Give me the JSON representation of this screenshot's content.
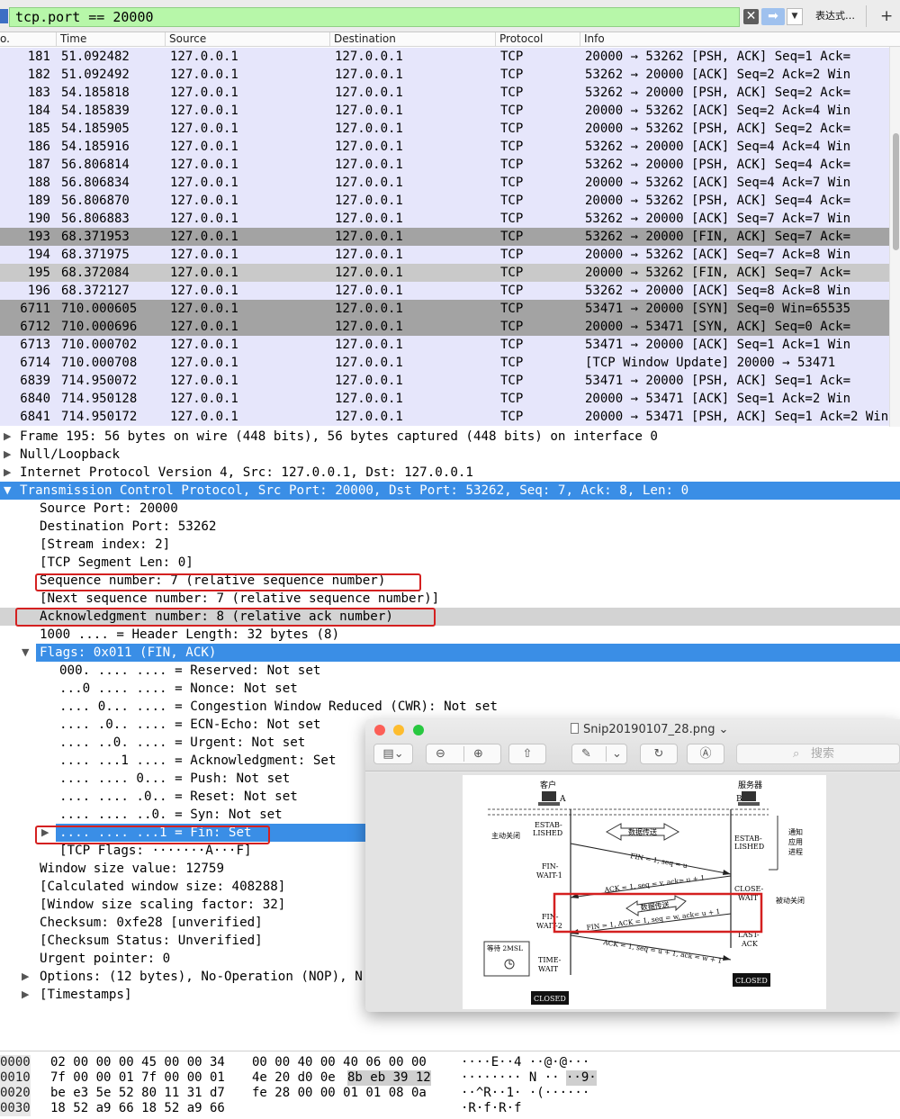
{
  "filter": {
    "value": "tcp.port == 20000",
    "clear_glyph": "✕",
    "apply_glyph": "➡",
    "dropdown_glyph": "▼",
    "expression_label": "表达式…",
    "add_glyph": "+"
  },
  "packet_list": {
    "columns": [
      "o.",
      "Time",
      "Source",
      "Destination",
      "Protocol",
      "Info"
    ],
    "rows": [
      {
        "no": "181",
        "time": "51.092482",
        "src": "127.0.0.1",
        "dst": "127.0.0.1",
        "proto": "TCP",
        "info": "20000 → 53262 [PSH, ACK] Seq=1 Ack="
      },
      {
        "no": "182",
        "time": "51.092492",
        "src": "127.0.0.1",
        "dst": "127.0.0.1",
        "proto": "TCP",
        "info": "53262 → 20000 [ACK] Seq=2 Ack=2 Win"
      },
      {
        "no": "183",
        "time": "54.185818",
        "src": "127.0.0.1",
        "dst": "127.0.0.1",
        "proto": "TCP",
        "info": "53262 → 20000 [PSH, ACK] Seq=2 Ack="
      },
      {
        "no": "184",
        "time": "54.185839",
        "src": "127.0.0.1",
        "dst": "127.0.0.1",
        "proto": "TCP",
        "info": "20000 → 53262 [ACK] Seq=2 Ack=4 Win"
      },
      {
        "no": "185",
        "time": "54.185905",
        "src": "127.0.0.1",
        "dst": "127.0.0.1",
        "proto": "TCP",
        "info": "20000 → 53262 [PSH, ACK] Seq=2 Ack="
      },
      {
        "no": "186",
        "time": "54.185916",
        "src": "127.0.0.1",
        "dst": "127.0.0.1",
        "proto": "TCP",
        "info": "53262 → 20000 [ACK] Seq=4 Ack=4 Win"
      },
      {
        "no": "187",
        "time": "56.806814",
        "src": "127.0.0.1",
        "dst": "127.0.0.1",
        "proto": "TCP",
        "info": "53262 → 20000 [PSH, ACK] Seq=4 Ack="
      },
      {
        "no": "188",
        "time": "56.806834",
        "src": "127.0.0.1",
        "dst": "127.0.0.1",
        "proto": "TCP",
        "info": "20000 → 53262 [ACK] Seq=4 Ack=7 Win"
      },
      {
        "no": "189",
        "time": "56.806870",
        "src": "127.0.0.1",
        "dst": "127.0.0.1",
        "proto": "TCP",
        "info": "20000 → 53262 [PSH, ACK] Seq=4 Ack="
      },
      {
        "no": "190",
        "time": "56.806883",
        "src": "127.0.0.1",
        "dst": "127.0.0.1",
        "proto": "TCP",
        "info": "53262 → 20000 [ACK] Seq=7 Ack=7 Win"
      },
      {
        "no": "193",
        "time": "68.371953",
        "src": "127.0.0.1",
        "dst": "127.0.0.1",
        "proto": "TCP",
        "info": "53262 → 20000 [FIN, ACK] Seq=7 Ack="
      },
      {
        "no": "194",
        "time": "68.371975",
        "src": "127.0.0.1",
        "dst": "127.0.0.1",
        "proto": "TCP",
        "info": "20000 → 53262 [ACK] Seq=7 Ack=8 Win"
      },
      {
        "no": "195",
        "time": "68.372084",
        "src": "127.0.0.1",
        "dst": "127.0.0.1",
        "proto": "TCP",
        "info": "20000 → 53262 [FIN, ACK] Seq=7 Ack="
      },
      {
        "no": "196",
        "time": "68.372127",
        "src": "127.0.0.1",
        "dst": "127.0.0.1",
        "proto": "TCP",
        "info": "53262 → 20000 [ACK] Seq=8 Ack=8 Win"
      },
      {
        "no": "6711",
        "time": "710.000605",
        "src": "127.0.0.1",
        "dst": "127.0.0.1",
        "proto": "TCP",
        "info": "53471 → 20000 [SYN] Seq=0 Win=65535"
      },
      {
        "no": "6712",
        "time": "710.000696",
        "src": "127.0.0.1",
        "dst": "127.0.0.1",
        "proto": "TCP",
        "info": "20000 → 53471 [SYN, ACK] Seq=0 Ack="
      },
      {
        "no": "6713",
        "time": "710.000702",
        "src": "127.0.0.1",
        "dst": "127.0.0.1",
        "proto": "TCP",
        "info": "53471 → 20000 [ACK] Seq=1 Ack=1 Win"
      },
      {
        "no": "6714",
        "time": "710.000708",
        "src": "127.0.0.1",
        "dst": "127.0.0.1",
        "proto": "TCP",
        "info": "[TCP Window Update] 20000 → 53471"
      },
      {
        "no": "6839",
        "time": "714.950072",
        "src": "127.0.0.1",
        "dst": "127.0.0.1",
        "proto": "TCP",
        "info": "53471 → 20000 [PSH, ACK] Seq=1 Ack="
      },
      {
        "no": "6840",
        "time": "714.950128",
        "src": "127.0.0.1",
        "dst": "127.0.0.1",
        "proto": "TCP",
        "info": "20000 → 53471 [ACK] Seq=1 Ack=2 Win"
      },
      {
        "no": "6841",
        "time": "714.950172",
        "src": "127.0.0.1",
        "dst": "127.0.0.1",
        "proto": "TCP",
        "info": "20000 → 53471 [PSH, ACK] Seq=1 Ack=2 Win"
      }
    ]
  },
  "details": {
    "frame": "Frame 195: 56 bytes on wire (448 bits), 56 bytes captured (448 bits) on interface 0",
    "null_loopback": "Null/Loopback",
    "ipv4": "Internet Protocol Version 4, Src: 127.0.0.1, Dst: 127.0.0.1",
    "tcp": "Transmission Control Protocol, Src Port: 20000, Dst Port: 53262, Seq: 7, Ack: 8, Len: 0",
    "src_port": "Source Port: 20000",
    "dst_port": "Destination Port: 53262",
    "stream_index": "[Stream index: 2]",
    "seg_len": "[TCP Segment Len: 0]",
    "seq_num": "Sequence number: 7    (relative sequence number)",
    "next_seq": "[Next sequence number: 7    (relative sequence number)]",
    "ack_num": "Acknowledgment number: 8    (relative ack number)",
    "hdr_len": "1000 .... = Header Length: 32 bytes (8)",
    "flags": "Flags: 0x011 (FIN, ACK)",
    "f_reserved": "000. .... .... = Reserved: Not set",
    "f_nonce": "...0 .... .... = Nonce: Not set",
    "f_cwr": ".... 0... .... = Congestion Window Reduced (CWR): Not set",
    "f_ecn": ".... .0.. .... = ECN-Echo: Not set",
    "f_urg": ".... ..0. .... = Urgent: Not set",
    "f_ack": ".... ...1 .... = Acknowledgment: Set",
    "f_push": ".... .... 0... = Push: Not set",
    "f_reset": ".... .... .0.. = Reset: Not set",
    "f_syn": ".... .... ..0. = Syn: Not set",
    "f_fin": ".... .... ...1 = Fin: Set",
    "tcp_flags_str": "[TCP Flags: ·······A···F]",
    "win_size": "Window size value: 12759",
    "calc_win": "[Calculated window size: 408288]",
    "win_scale": "[Window size scaling factor: 32]",
    "checksum": "Checksum: 0xfe28 [unverified]",
    "checksum_status": "[Checksum Status: Unverified]",
    "urgent_ptr": "Urgent pointer: 0",
    "options": "Options: (12 bytes), No-Operation (NOP), N",
    "timestamps": "[Timestamps]"
  },
  "hex": {
    "rows": [
      {
        "off": "0000",
        "a": "02 00 00 00 45 00 00 34",
        "b": "00 00 40 00 40 06 00 00",
        "ascii": "····E··4 ··@·@···"
      },
      {
        "off": "0010",
        "a": "7f 00 00 01 7f 00 00 01",
        "b1": "4e 20 d0 0e",
        "b2": "8b eb 39 12",
        "ascii1": "········ N ··",
        "ascii2": "··9·"
      },
      {
        "off": "0020",
        "a": "be e3 5e 52 80 11 31 d7",
        "b": "fe 28 00 00 01 01 08 0a",
        "ascii": "··^R··1· ·(······"
      },
      {
        "off": "0030",
        "a": "18 52 a9 66 18 52 a9 66",
        "b": "",
        "ascii": "·R·f·R·f"
      }
    ]
  },
  "preview": {
    "title": "Snip20190107_28.png",
    "title_chevron": "⌄",
    "search_placeholder": "搜索",
    "diagram": {
      "client": "客户",
      "server": "服务器",
      "a": "A",
      "b": "B",
      "estab": "ESTAB-",
      "lished": "LISHED",
      "active_close": "主动关闭",
      "notify": "通知",
      "app": "应用",
      "proc": "进程",
      "data_transfer": "数据传送",
      "fin_wait1a": "FIN-",
      "fin_wait1b": "WAIT-1",
      "fin_wait2a": "FIN-",
      "fin_wait2b": "WAIT-2",
      "close_wait_a": "CLOSE-",
      "close_wait_b": "WAIT",
      "passive_close": "被动关闭",
      "last_ack_a": "LAST-",
      "last_ack_b": "ACK",
      "time_wait_a": "TIME-",
      "time_wait_b": "WAIT",
      "wait_2msl": "等待 2MSL",
      "closed": "CLOSED",
      "seg1": "FIN = 1, seq = u",
      "seg2": "ACK = 1, seq = v, ack= u + 1",
      "seg3": "FIN = 1, ACK = 1, seq = w, ack= u + 1",
      "seg4": "ACK = 1, seq = u + 1, ack = w + 1"
    }
  },
  "colors": {
    "filter_bg": "#b7f7a9",
    "row_bg": "#e6e6fb",
    "row_dark": "#a3a3a3",
    "row_selected": "#c9c9c9",
    "detail_selected": "#3a8ee6",
    "highlight_red": "#d42020"
  }
}
